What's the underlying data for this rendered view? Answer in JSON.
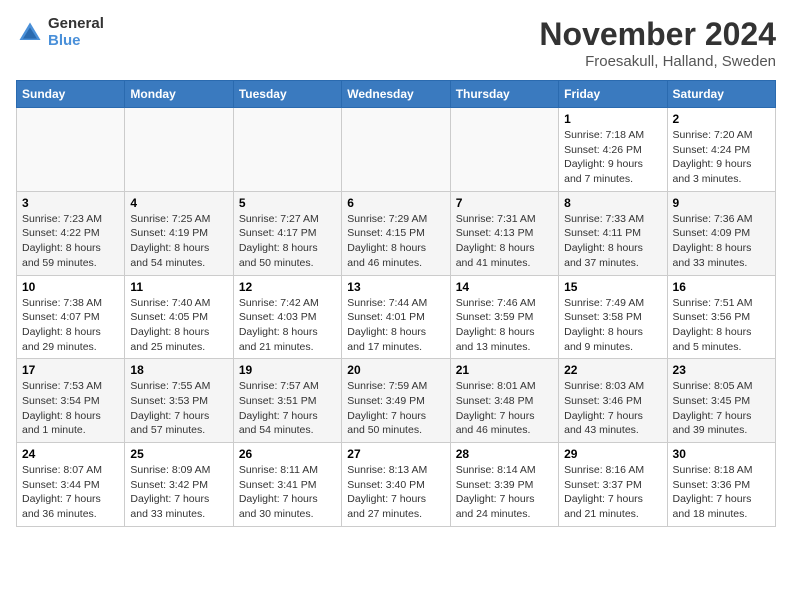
{
  "logo": {
    "general": "General",
    "blue": "Blue"
  },
  "header": {
    "title": "November 2024",
    "subtitle": "Froesakull, Halland, Sweden"
  },
  "days_of_week": [
    "Sunday",
    "Monday",
    "Tuesday",
    "Wednesday",
    "Thursday",
    "Friday",
    "Saturday"
  ],
  "weeks": [
    [
      {
        "day": "",
        "info": ""
      },
      {
        "day": "",
        "info": ""
      },
      {
        "day": "",
        "info": ""
      },
      {
        "day": "",
        "info": ""
      },
      {
        "day": "",
        "info": ""
      },
      {
        "day": "1",
        "info": "Sunrise: 7:18 AM\nSunset: 4:26 PM\nDaylight: 9 hours\nand 7 minutes."
      },
      {
        "day": "2",
        "info": "Sunrise: 7:20 AM\nSunset: 4:24 PM\nDaylight: 9 hours\nand 3 minutes."
      }
    ],
    [
      {
        "day": "3",
        "info": "Sunrise: 7:23 AM\nSunset: 4:22 PM\nDaylight: 8 hours\nand 59 minutes."
      },
      {
        "day": "4",
        "info": "Sunrise: 7:25 AM\nSunset: 4:19 PM\nDaylight: 8 hours\nand 54 minutes."
      },
      {
        "day": "5",
        "info": "Sunrise: 7:27 AM\nSunset: 4:17 PM\nDaylight: 8 hours\nand 50 minutes."
      },
      {
        "day": "6",
        "info": "Sunrise: 7:29 AM\nSunset: 4:15 PM\nDaylight: 8 hours\nand 46 minutes."
      },
      {
        "day": "7",
        "info": "Sunrise: 7:31 AM\nSunset: 4:13 PM\nDaylight: 8 hours\nand 41 minutes."
      },
      {
        "day": "8",
        "info": "Sunrise: 7:33 AM\nSunset: 4:11 PM\nDaylight: 8 hours\nand 37 minutes."
      },
      {
        "day": "9",
        "info": "Sunrise: 7:36 AM\nSunset: 4:09 PM\nDaylight: 8 hours\nand 33 minutes."
      }
    ],
    [
      {
        "day": "10",
        "info": "Sunrise: 7:38 AM\nSunset: 4:07 PM\nDaylight: 8 hours\nand 29 minutes."
      },
      {
        "day": "11",
        "info": "Sunrise: 7:40 AM\nSunset: 4:05 PM\nDaylight: 8 hours\nand 25 minutes."
      },
      {
        "day": "12",
        "info": "Sunrise: 7:42 AM\nSunset: 4:03 PM\nDaylight: 8 hours\nand 21 minutes."
      },
      {
        "day": "13",
        "info": "Sunrise: 7:44 AM\nSunset: 4:01 PM\nDaylight: 8 hours\nand 17 minutes."
      },
      {
        "day": "14",
        "info": "Sunrise: 7:46 AM\nSunset: 3:59 PM\nDaylight: 8 hours\nand 13 minutes."
      },
      {
        "day": "15",
        "info": "Sunrise: 7:49 AM\nSunset: 3:58 PM\nDaylight: 8 hours\nand 9 minutes."
      },
      {
        "day": "16",
        "info": "Sunrise: 7:51 AM\nSunset: 3:56 PM\nDaylight: 8 hours\nand 5 minutes."
      }
    ],
    [
      {
        "day": "17",
        "info": "Sunrise: 7:53 AM\nSunset: 3:54 PM\nDaylight: 8 hours\nand 1 minute."
      },
      {
        "day": "18",
        "info": "Sunrise: 7:55 AM\nSunset: 3:53 PM\nDaylight: 7 hours\nand 57 minutes."
      },
      {
        "day": "19",
        "info": "Sunrise: 7:57 AM\nSunset: 3:51 PM\nDaylight: 7 hours\nand 54 minutes."
      },
      {
        "day": "20",
        "info": "Sunrise: 7:59 AM\nSunset: 3:49 PM\nDaylight: 7 hours\nand 50 minutes."
      },
      {
        "day": "21",
        "info": "Sunrise: 8:01 AM\nSunset: 3:48 PM\nDaylight: 7 hours\nand 46 minutes."
      },
      {
        "day": "22",
        "info": "Sunrise: 8:03 AM\nSunset: 3:46 PM\nDaylight: 7 hours\nand 43 minutes."
      },
      {
        "day": "23",
        "info": "Sunrise: 8:05 AM\nSunset: 3:45 PM\nDaylight: 7 hours\nand 39 minutes."
      }
    ],
    [
      {
        "day": "24",
        "info": "Sunrise: 8:07 AM\nSunset: 3:44 PM\nDaylight: 7 hours\nand 36 minutes."
      },
      {
        "day": "25",
        "info": "Sunrise: 8:09 AM\nSunset: 3:42 PM\nDaylight: 7 hours\nand 33 minutes."
      },
      {
        "day": "26",
        "info": "Sunrise: 8:11 AM\nSunset: 3:41 PM\nDaylight: 7 hours\nand 30 minutes."
      },
      {
        "day": "27",
        "info": "Sunrise: 8:13 AM\nSunset: 3:40 PM\nDaylight: 7 hours\nand 27 minutes."
      },
      {
        "day": "28",
        "info": "Sunrise: 8:14 AM\nSunset: 3:39 PM\nDaylight: 7 hours\nand 24 minutes."
      },
      {
        "day": "29",
        "info": "Sunrise: 8:16 AM\nSunset: 3:37 PM\nDaylight: 7 hours\nand 21 minutes."
      },
      {
        "day": "30",
        "info": "Sunrise: 8:18 AM\nSunset: 3:36 PM\nDaylight: 7 hours\nand 18 minutes."
      }
    ]
  ]
}
